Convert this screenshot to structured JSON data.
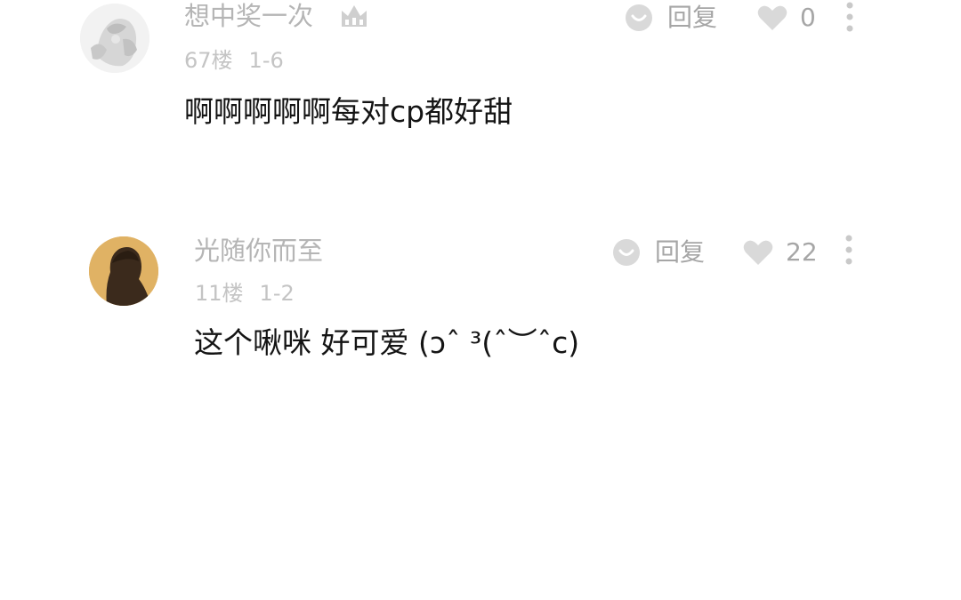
{
  "comments": [
    {
      "username": "想中奖一次",
      "floor": "67楼",
      "date": "1-6",
      "content": "啊啊啊啊啊每对cp都好甜",
      "reply_label": "回复",
      "like_count": "0",
      "avatar_icon": "anime-illustration-avatar",
      "badge_icon": "crown-icon"
    },
    {
      "username": "光随你而至",
      "floor": "11楼",
      "date": "1-2",
      "content": "这个啾咪 好可爱 (ↄˆ ³(ˆ︶ˆc)",
      "reply_label": "回复",
      "like_count": "22",
      "avatar_icon": "silhouette-avatar"
    }
  ],
  "colors": {
    "secondary_text": "#b5b5b5",
    "icon_gray": "#d9d9d9",
    "content_text": "#141414",
    "avatar2_bg": "#e0b264"
  }
}
